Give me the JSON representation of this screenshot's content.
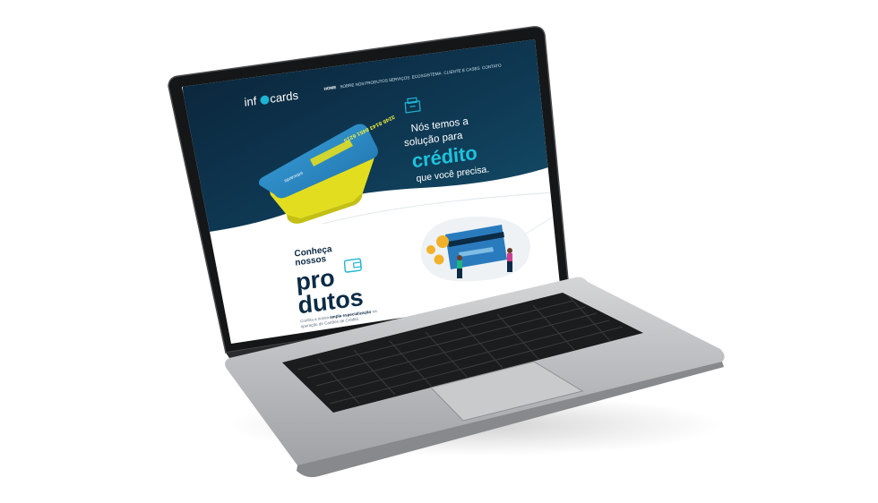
{
  "site": {
    "logo": {
      "part1": "inf",
      "part2": "cards"
    },
    "nav": [
      "HOME",
      "SOBRE NÓS",
      "PRODUTOS",
      "SERVIÇOS",
      "ECOSSISTEMA",
      "CLIENTE E CASES",
      "CONTATO"
    ],
    "hero": {
      "line1": "Nós temos a",
      "line2": "solução para",
      "highlight": "crédito",
      "line3": "que você precisa.",
      "card_number": "3245 8143 8451 6215",
      "card_brand": "infocards"
    },
    "products": {
      "eyebrow1": "Conheça",
      "eyebrow2": "nossos",
      "title1": "pro",
      "title2": "dutos",
      "desc1_a": "Confira a nossa",
      "desc1_b": "ampla especialização",
      "desc1_c": "na",
      "desc2": "operação de Cartões de Crédito."
    }
  },
  "colors": {
    "navy": "#0c2b45",
    "teal": "#1fb4d2",
    "card_blue": "#2f8fc9",
    "card_yellow": "#e3e021",
    "laptop_silver": "#b8b9bb"
  }
}
